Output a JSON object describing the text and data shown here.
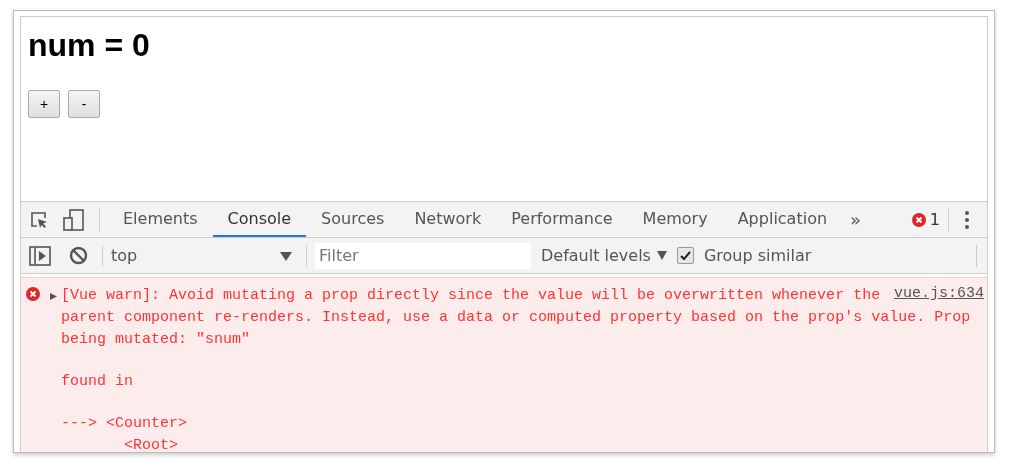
{
  "page": {
    "heading": "num = 0",
    "buttons": [
      "+",
      "-"
    ]
  },
  "devtools": {
    "tabs": [
      {
        "label": "Elements",
        "selected": false
      },
      {
        "label": "Console",
        "selected": true
      },
      {
        "label": "Sources",
        "selected": false
      },
      {
        "label": "Network",
        "selected": false
      },
      {
        "label": "Performance",
        "selected": false
      },
      {
        "label": "Memory",
        "selected": false
      },
      {
        "label": "Application",
        "selected": false
      }
    ],
    "more": "»",
    "error_count": "1"
  },
  "console_toolbar": {
    "context": "top",
    "filter_placeholder": "Filter",
    "levels": "Default levels",
    "group_similar": {
      "label": "Group similar",
      "checked": true
    }
  },
  "messages": [
    {
      "kind": "error",
      "expanded": false,
      "source": "vue.js:634",
      "blocks": [
        {
          "lines": [
            "[Vue warn]: Avoid mutating a prop directly since the value will be overwritten whenever the",
            "parent component re-renders. Instead, use a data or computed property based on the prop's value. Prop",
            "being mutated: \"snum\""
          ]
        },
        {
          "lines": [
            "found in"
          ]
        },
        {
          "lines": [
            "---> <Counter>",
            "       <Root>"
          ]
        }
      ]
    }
  ]
}
